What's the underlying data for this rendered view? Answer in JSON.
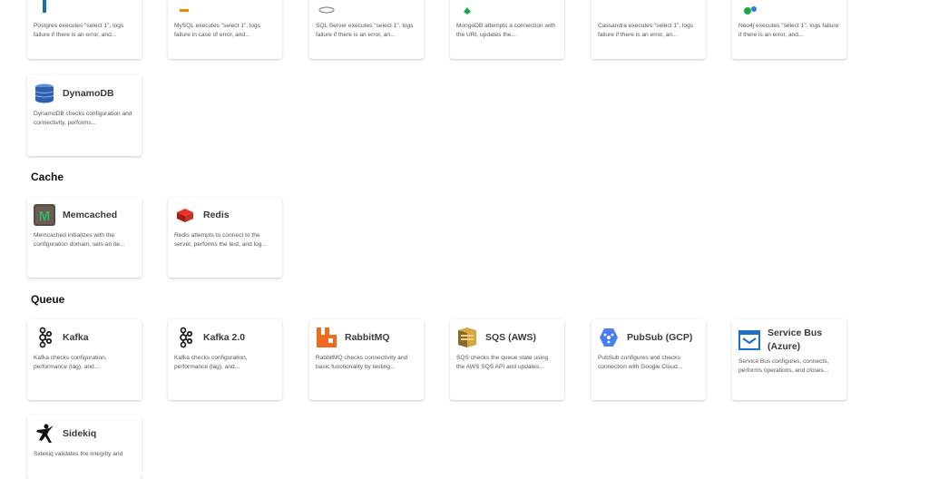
{
  "top_row": [
    {
      "desc": "Postgres executes \"select 1\", logs failure if there is an error, and..."
    },
    {
      "desc": "MySQL executes \"select 1\", logs failure in case of error, and..."
    },
    {
      "desc": "SQL Server executes \"select 1\", logs failure if there is an error, an..."
    },
    {
      "desc": "MongoDB attempts a connection with the URI, updates the..."
    },
    {
      "desc": "Cassandra executes \"select 1\", logs failure if there is an error, an..."
    },
    {
      "desc": "Neo4j executes \"select 1\", logs failure if there is an error, and..."
    }
  ],
  "dynamo": {
    "title": "DynamoDB",
    "desc": "DynamoDB checks configuration and connectivity, performs..."
  },
  "cache": {
    "heading": "Cache",
    "items": [
      {
        "title": "Memcached",
        "desc": "Memcached initializes with the configuration domain, sets an ite..."
      },
      {
        "title": "Redis",
        "desc": "Redis attempts to connect to the server, performs the test, and log..."
      }
    ]
  },
  "queue": {
    "heading": "Queue",
    "items": [
      {
        "title": "Kafka",
        "desc": "Kafka checks configuration, performance (lag), and..."
      },
      {
        "title": "Kafka 2.0",
        "desc": "Kafka checks configuration, performance (lag), and..."
      },
      {
        "title": "RabbitMQ",
        "desc": "RabbitMQ checks connectivity and basic functionality by testing..."
      },
      {
        "title": "SQS (AWS)",
        "desc": "SQS checks the queue state using the AWS SQS API and updates..."
      },
      {
        "title": "PubSub (GCP)",
        "desc": "PubSub configures and checks connection with Google Cloud..."
      },
      {
        "title": "Service Bus (Azure)",
        "desc": "Service Bus configures, connects, performs operations, and closes..."
      }
    ]
  },
  "sidekiq": {
    "title": "Sidekiq",
    "desc": "Sidekiq validates the integrity and"
  }
}
